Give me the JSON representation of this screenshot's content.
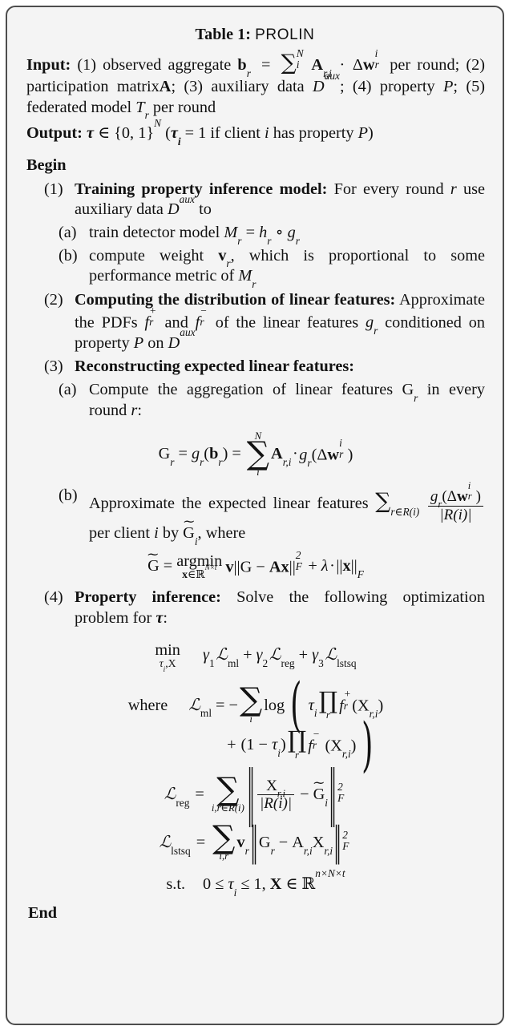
{
  "caption": {
    "label": "Table 1:",
    "name": "PROLIN"
  },
  "keywords": {
    "input": "Input:",
    "output": "Output:",
    "begin": "Begin",
    "end": "End",
    "where": "where",
    "subject_to": "s.t."
  },
  "io": {
    "input_text_1": "(1) observed aggregate",
    "input_text_2": "per round; (2) participation matrix",
    "input_text_3": "; (3) auxiliary data",
    "input_text_4": "; (4) property",
    "input_text_5": "; (5) federated model",
    "input_text_6": "per round",
    "output_text_1": "if client",
    "output_text_2": "has property"
  },
  "steps": [
    {
      "marker": "(1)",
      "title": "Training property inference model:",
      "text": "For every round",
      "text_2": "use auxiliary data",
      "text_3": "to",
      "substeps": [
        {
          "marker": "(a)",
          "text": "train detector model"
        },
        {
          "marker": "(b)",
          "text": "compute weight",
          "text_2": ", which is proportional to some performance metric of"
        }
      ]
    },
    {
      "marker": "(2)",
      "title": "Computing the distribution of linear features:",
      "text": "Approximate the PDFs",
      "text_2": "and",
      "text_3": "of the linear features",
      "text_4": "conditioned on property",
      "text_5": "on"
    },
    {
      "marker": "(3)",
      "title": "Reconstructing expected linear features:",
      "substeps": [
        {
          "marker": "(a)",
          "text": "Compute the aggregation of linear features",
          "text_2": "in every round",
          "text_3": ":"
        },
        {
          "marker": "(b)",
          "text": "Approximate the expected linear features",
          "text_2": "per client",
          "text_3": "by",
          "text_4": ", where"
        }
      ]
    },
    {
      "marker": "(4)",
      "title": "Property inference:",
      "text": "Solve the following optimization problem for",
      "text_2": ":"
    }
  ],
  "symbols": {
    "b": "b",
    "A": "A",
    "D": "D",
    "aux": "aux",
    "P": "P",
    "T": "T",
    "tau": "τ",
    "N": "N",
    "i": "i",
    "r": "r",
    "M": "M",
    "h": "h",
    "g": "g",
    "v": "v",
    "G": "G",
    "f": "f",
    "x": "x",
    "X": "X",
    "lambda": "λ",
    "gamma": "γ",
    "L": "ℒ",
    "delta": "Δ",
    "w": "w",
    "R": "R",
    "t": "t",
    "n": "n",
    "sum": "∑",
    "prod": "∏",
    "reals": "ℝ",
    "in": "∈",
    "circ": "∘",
    "cdot": "·",
    "times": "×",
    "leq": "≤",
    "minus": "−",
    "plus": "+",
    "equals": "=",
    "F": "F",
    "one": "1",
    "zero": "0",
    "two": "2",
    "three": "3",
    "braceL": "{",
    "braceR": "}",
    "log": "log",
    "argmin": "argmin",
    "min": "min",
    "tilde": "∼",
    "ml": "ml",
    "reg": "reg",
    "lstsq": "lstsq"
  },
  "colors": {
    "border": "#4d4d4d",
    "background": "#f4f4f4",
    "text": "#121212"
  }
}
